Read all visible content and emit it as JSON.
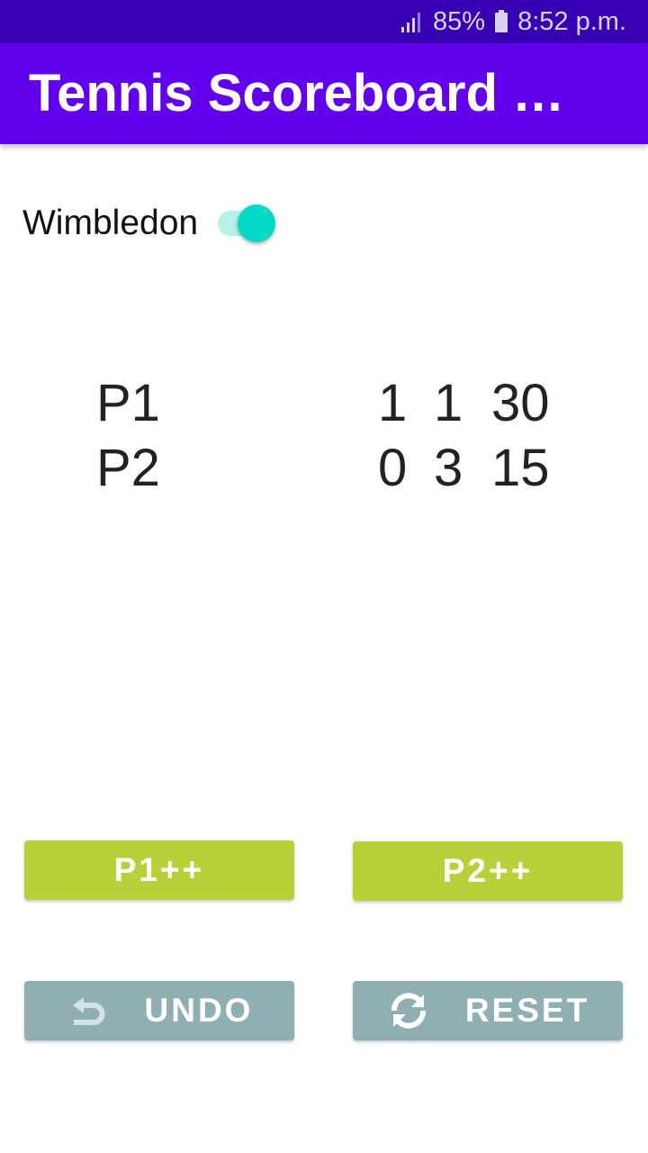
{
  "status_bar": {
    "battery": "85%",
    "time": "8:52 p.m.",
    "icons": [
      "signal-icon",
      "battery-icon"
    ]
  },
  "app_bar": {
    "title": "Tennis Scoreboard M…"
  },
  "wimbledon_switch": {
    "label": "Wimbledon",
    "on": true,
    "accent_color": "#03dac5"
  },
  "scoreboard": {
    "players": [
      {
        "name": "P1",
        "sets": "1",
        "games": "1",
        "points": "30"
      },
      {
        "name": "P2",
        "sets": "0",
        "games": "3",
        "points": "15"
      }
    ]
  },
  "buttons": {
    "p1_label": "P1++",
    "p2_label": "P2++",
    "undo_label": "UNDO",
    "reset_label": "RESET",
    "undo_icon": "undo-icon",
    "reset_icon": "refresh-icon"
  },
  "colors": {
    "status_bar": "#3700b3",
    "app_bar": "#6200ee",
    "score_button": "#b8d03a",
    "action_button": "#8fafb3"
  }
}
